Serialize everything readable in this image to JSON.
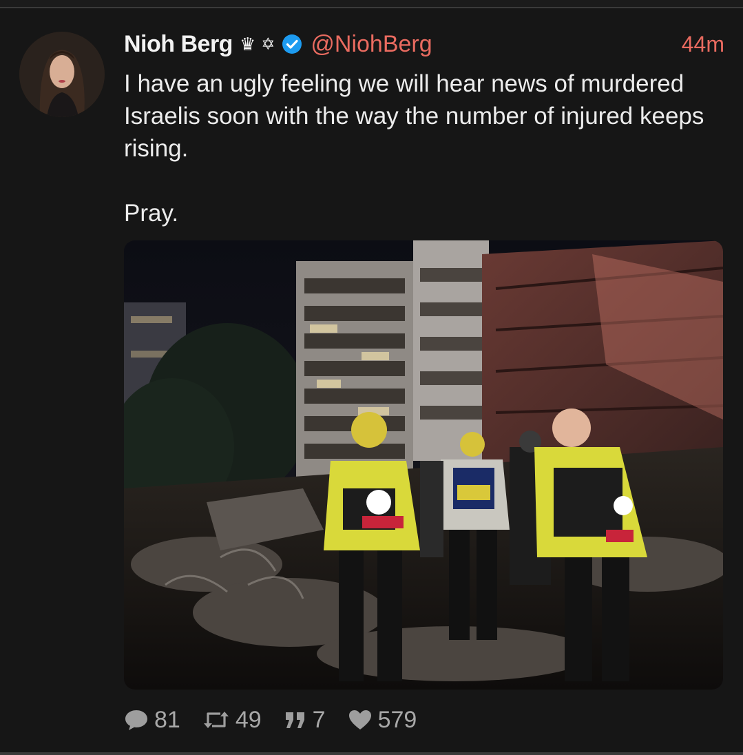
{
  "post": {
    "author_name": "Nioh Berg",
    "handle": "@NiohBerg",
    "time": "44m",
    "badges": [
      "crown-icon",
      "star-of-david-icon",
      "verified-icon"
    ],
    "text": "I have an ugly feeling we will hear news of murdered Israelis soon with the way the number of injured keeps rising.\n\nPray.",
    "photo": "night rescue scene with responders in hi-vis vests beside damaged apartment buildings"
  },
  "stats": {
    "replies": "81",
    "reposts": "49",
    "quotes": "7",
    "likes": "579"
  },
  "colors": {
    "background": "#161616",
    "accent": "#ea6b60",
    "verified": "#1d9bf0",
    "muted": "#9e9e9e"
  }
}
